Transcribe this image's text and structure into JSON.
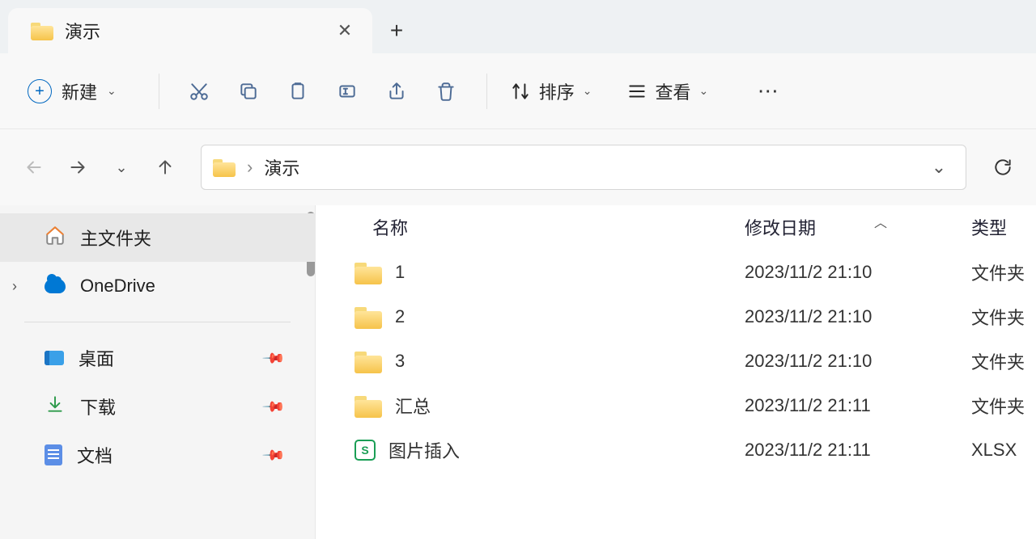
{
  "tab": {
    "title": "演示"
  },
  "toolbar": {
    "new_label": "新建",
    "sort_label": "排序",
    "view_label": "查看"
  },
  "breadcrumb": {
    "current": "演示"
  },
  "sidebar": {
    "home": "主文件夹",
    "onedrive": "OneDrive",
    "desktop": "桌面",
    "downloads": "下载",
    "documents": "文档"
  },
  "columns": {
    "name": "名称",
    "modified": "修改日期",
    "type": "类型"
  },
  "files": [
    {
      "name": "1",
      "modified": "2023/11/2 21:10",
      "type": "文件夹",
      "kind": "folder"
    },
    {
      "name": "2",
      "modified": "2023/11/2 21:10",
      "type": "文件夹",
      "kind": "folder"
    },
    {
      "name": "3",
      "modified": "2023/11/2 21:10",
      "type": "文件夹",
      "kind": "folder"
    },
    {
      "name": "汇总",
      "modified": "2023/11/2 21:11",
      "type": "文件夹",
      "kind": "folder"
    },
    {
      "name": "图片插入",
      "modified": "2023/11/2 21:11",
      "type": "XLSX",
      "kind": "xlsx"
    }
  ]
}
